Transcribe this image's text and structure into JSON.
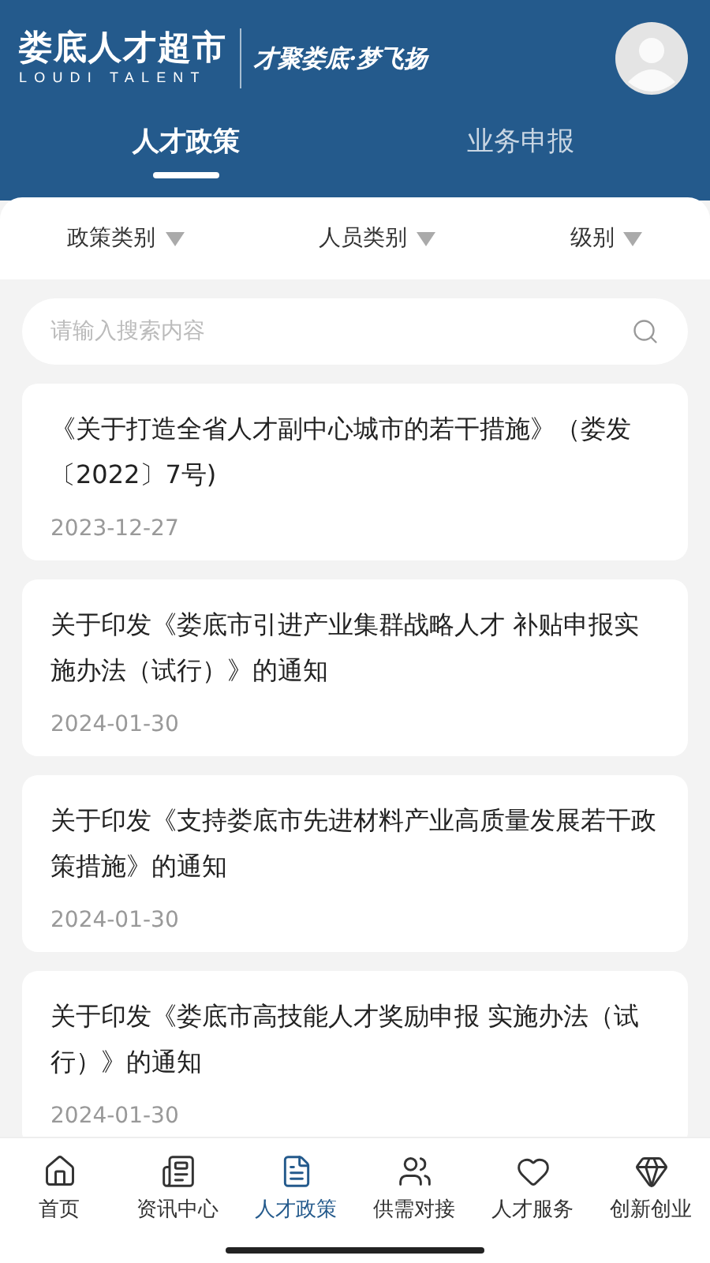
{
  "header": {
    "logo_title": "娄底人才超市",
    "logo_subtitle": "LOUDI TALENT",
    "slogan": "才聚娄底·梦飞扬"
  },
  "tabs": [
    {
      "label": "人才政策",
      "selected": true
    },
    {
      "label": "业务申报",
      "selected": false
    }
  ],
  "filters": [
    "政策类别",
    "人员类别",
    "级别"
  ],
  "search": {
    "placeholder": "请输入搜索内容"
  },
  "policies": [
    {
      "title": "《关于打造全省人才副中心城市的若干措施》（娄发〔2022〕7号)",
      "date": "2023-12-27"
    },
    {
      "title": "关于印发《娄底市引进产业集群战略人才 补贴申报实施办法（试行）》的通知",
      "date": "2024-01-30"
    },
    {
      "title": "关于印发《支持娄底市先进材料产业高质量发展若干政策措施》的通知",
      "date": "2024-01-30"
    },
    {
      "title": "关于印发《娄底市高技能人才奖励申报 实施办法（试行）》的通知",
      "date": "2024-01-30"
    }
  ],
  "nav": [
    {
      "label": "首页",
      "kind": "home",
      "selected": false
    },
    {
      "label": "资讯中心",
      "kind": "news",
      "selected": false
    },
    {
      "label": "人才政策",
      "kind": "policy",
      "selected": true
    },
    {
      "label": "供需对接",
      "kind": "people",
      "selected": false
    },
    {
      "label": "人才服务",
      "kind": "heart",
      "selected": false
    },
    {
      "label": "创新创业",
      "kind": "gem",
      "selected": false
    }
  ]
}
